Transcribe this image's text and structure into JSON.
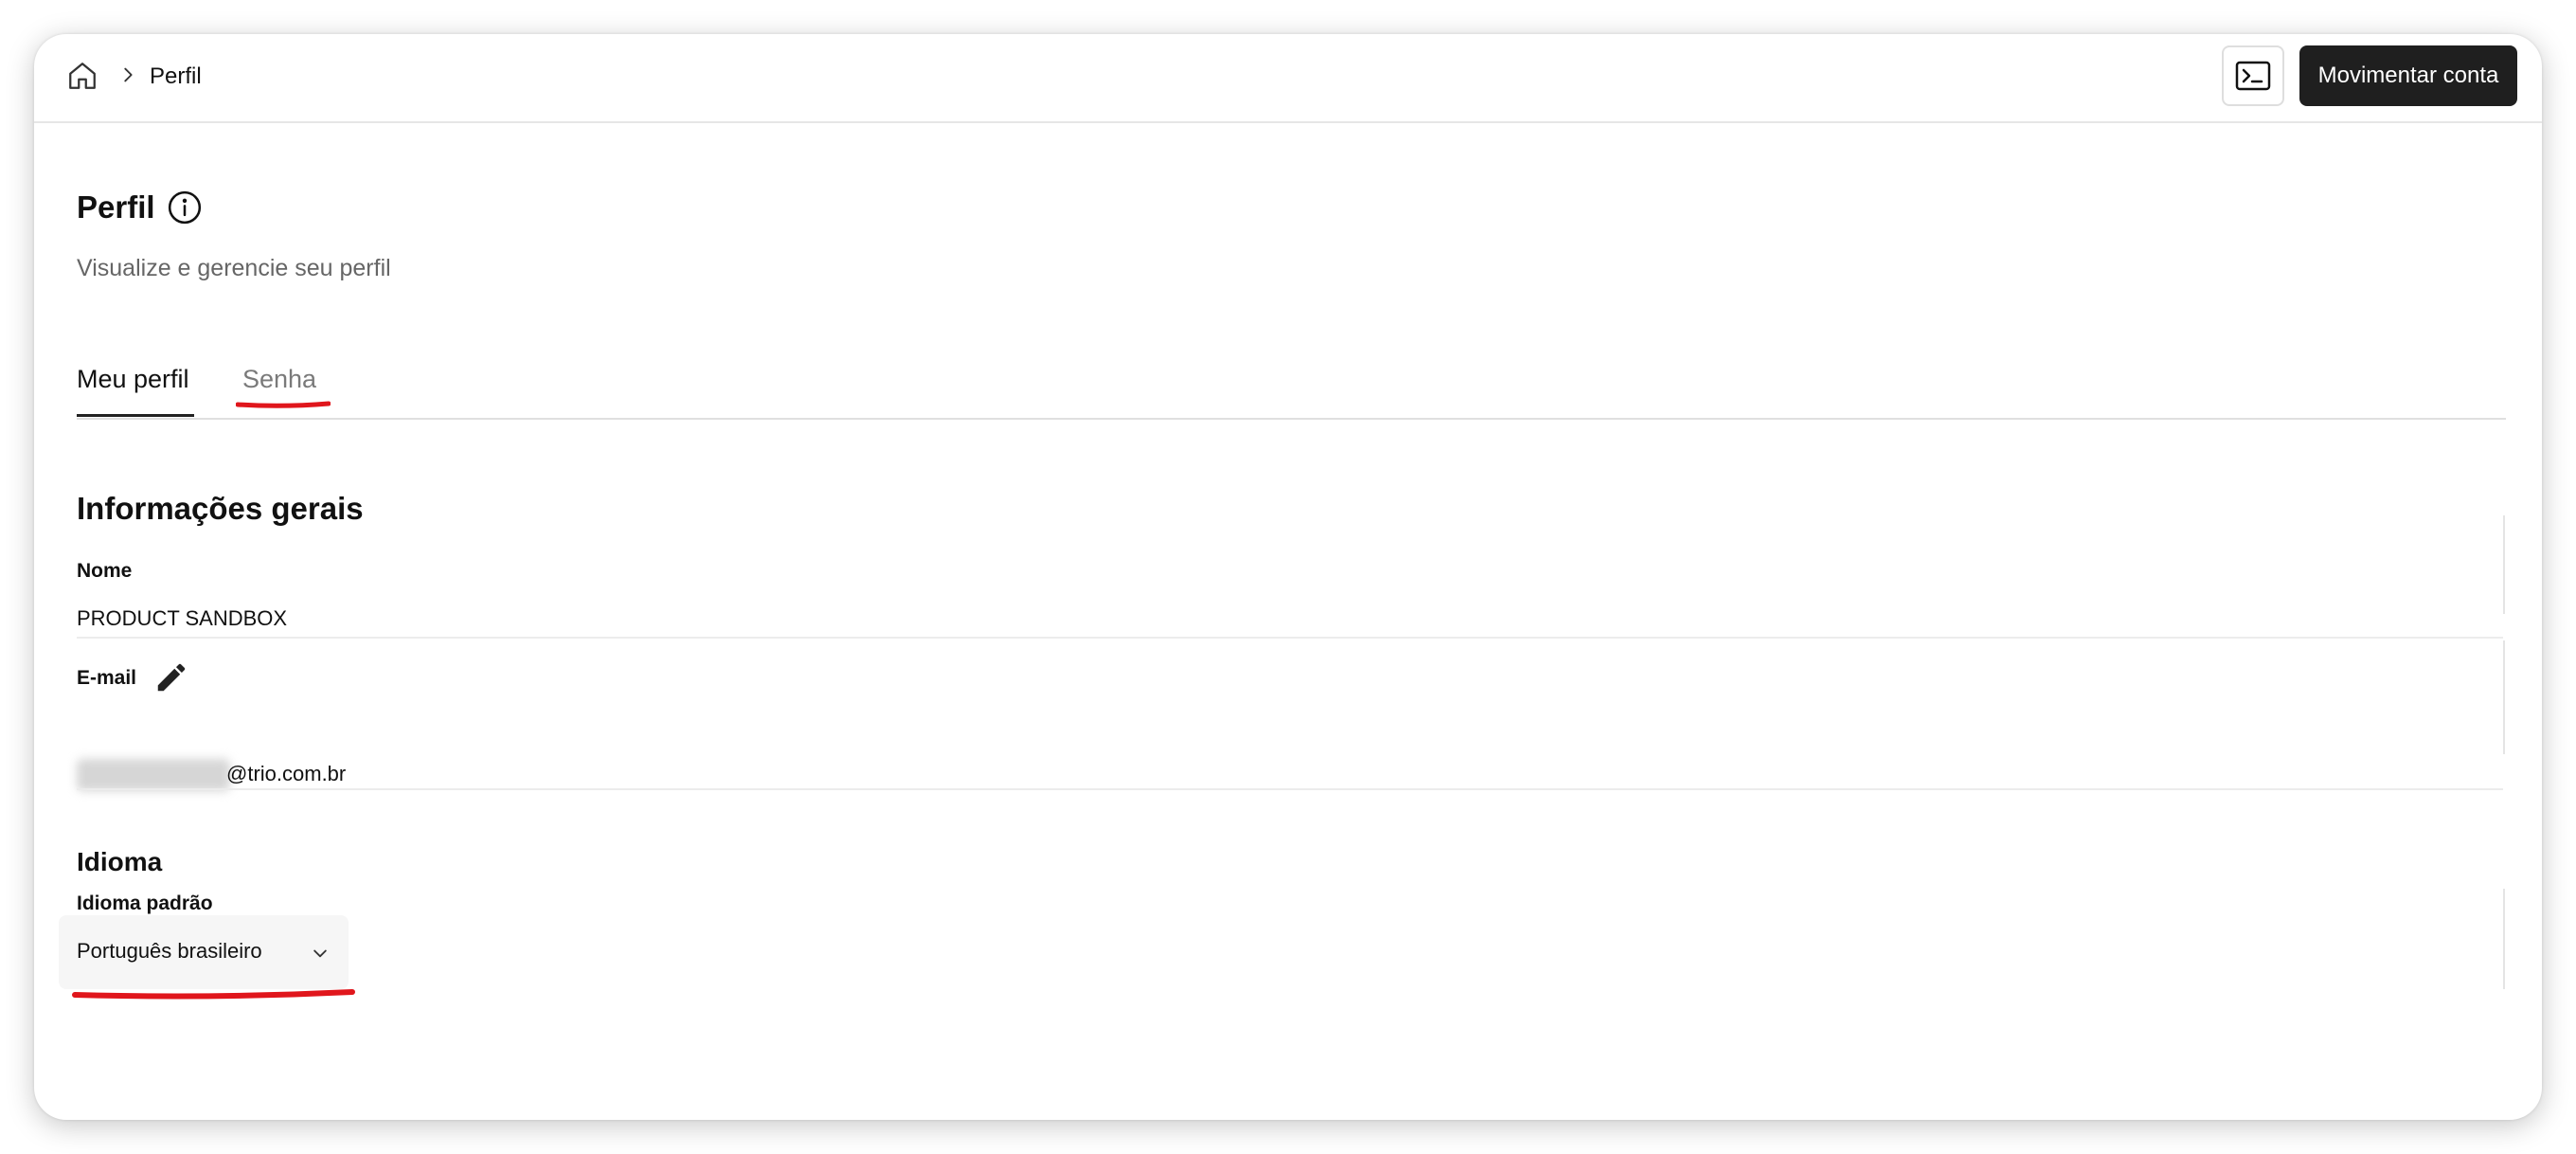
{
  "header": {
    "breadcrumb_current": "Perfil",
    "home_icon": "home-icon",
    "terminal_icon": "terminal-icon",
    "primary_button_label": "Movimentar conta"
  },
  "page": {
    "title": "Perfil",
    "subtitle": "Visualize e gerencie seu perfil"
  },
  "tabs": [
    {
      "label": "Meu perfil",
      "active": true
    },
    {
      "label": "Senha",
      "active": false
    }
  ],
  "general": {
    "title": "Informações gerais",
    "name_label": "Nome",
    "name_value": "PRODUCT SANDBOX",
    "email_label": "E-mail",
    "email_value_visible": "@trio.com.br"
  },
  "language": {
    "title": "Idioma",
    "field_label": "Idioma padrão",
    "selected": "Português brasileiro"
  },
  "colors": {
    "primary_button_bg": "#1f1f1f",
    "annotation_red": "#e0161c",
    "muted_text": "#666666"
  }
}
